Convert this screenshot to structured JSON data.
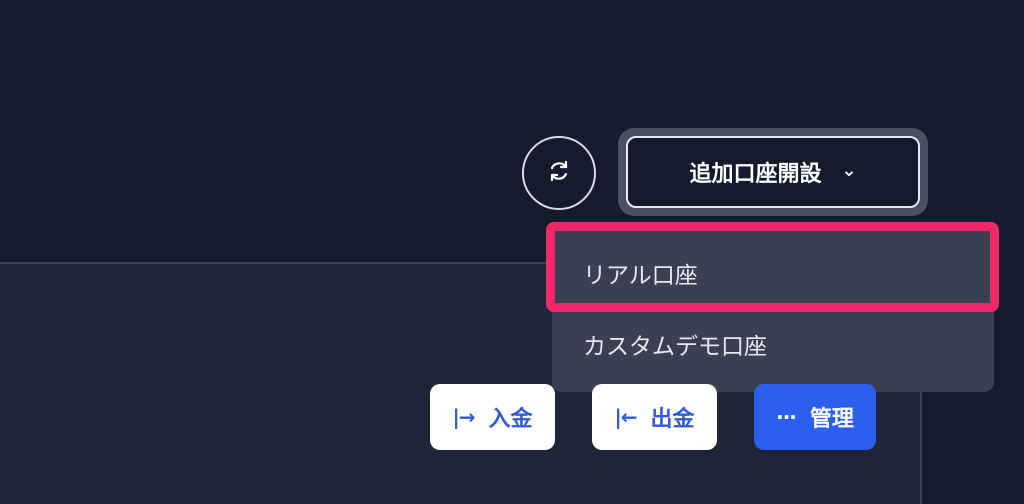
{
  "toolbar": {
    "refresh_icon": "refresh-icon",
    "open_account_label": "追加口座開設",
    "chevron_icon": "chevron-down-icon"
  },
  "menu": {
    "items": [
      {
        "label": "リアル口座"
      },
      {
        "label": "カスタムデモ口座"
      }
    ]
  },
  "actions": {
    "deposit": {
      "icon": "→",
      "label": "入金"
    },
    "withdraw": {
      "icon": "←",
      "label": "出金"
    },
    "manage": {
      "icon": "···",
      "label": "管理"
    }
  },
  "colors": {
    "background": "#151a2c",
    "panel": "#1f2538",
    "menu": "#3a4052",
    "highlight": "#f0286a",
    "primary": "#2a5ff0",
    "link": "#2f5bd9"
  }
}
